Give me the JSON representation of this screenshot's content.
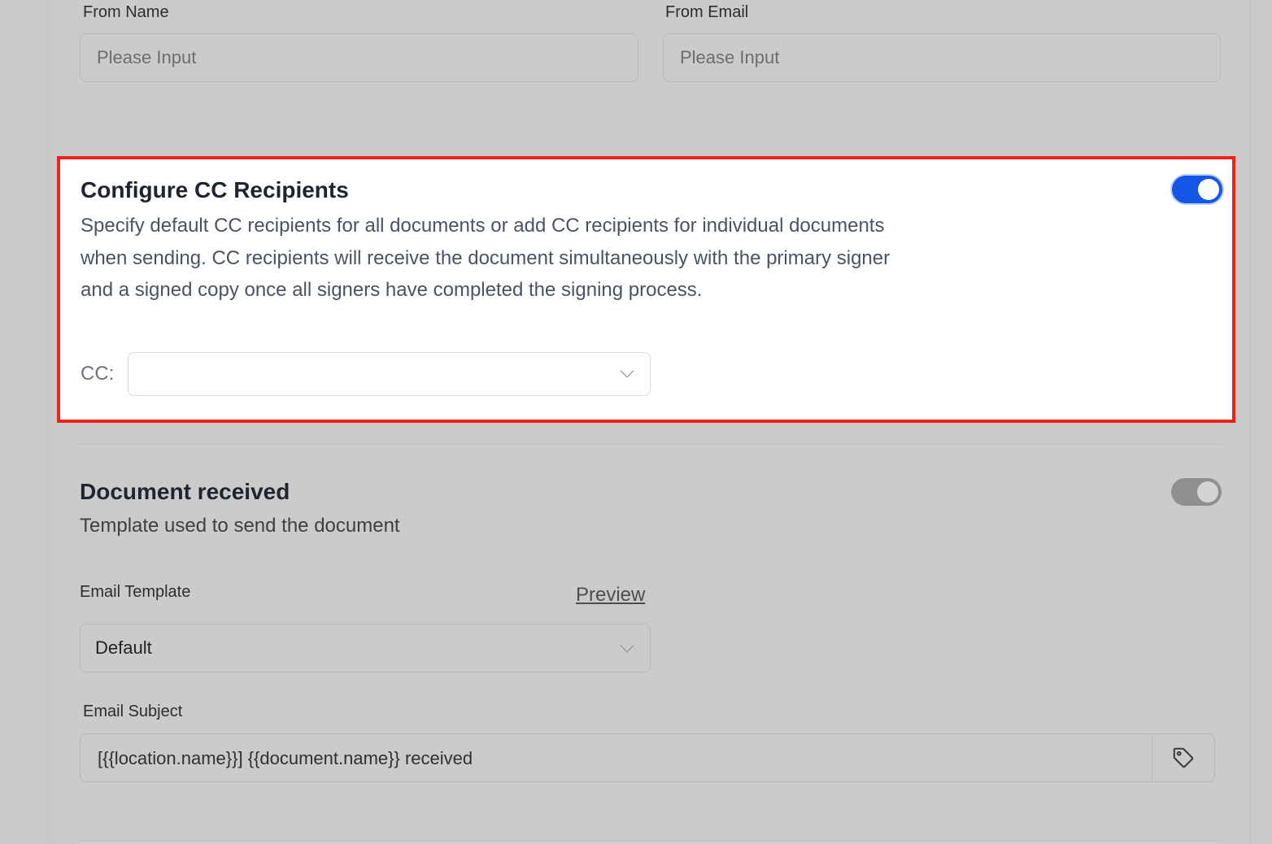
{
  "from": {
    "name_label": "From Name",
    "name_placeholder": "Please Input",
    "email_label": "From Email",
    "email_placeholder": "Please Input"
  },
  "cc_section": {
    "title": "Configure CC Recipients",
    "description_lines": [
      "Specify default CC recipients for all documents or add CC recipients for individual documents",
      "when sending. CC recipients will receive the document simultaneously with the primary signer",
      "and a signed copy once all signers have completed the signing process."
    ],
    "toggle_on": true,
    "cc_label": "CC:",
    "cc_value": "",
    "highlight_color": "#f2201b",
    "toggle_color": "#1556e6"
  },
  "document_received": {
    "title": "Document received",
    "description": "Template used to send the document",
    "toggle_on": false,
    "email_template_label": "Email Template",
    "preview_link": "Preview",
    "email_template_value": "Default",
    "email_subject_label": "Email Subject",
    "email_subject_value": "[{{location.name}}] {{document.name}} received",
    "tag_icon": "tag-icon"
  }
}
